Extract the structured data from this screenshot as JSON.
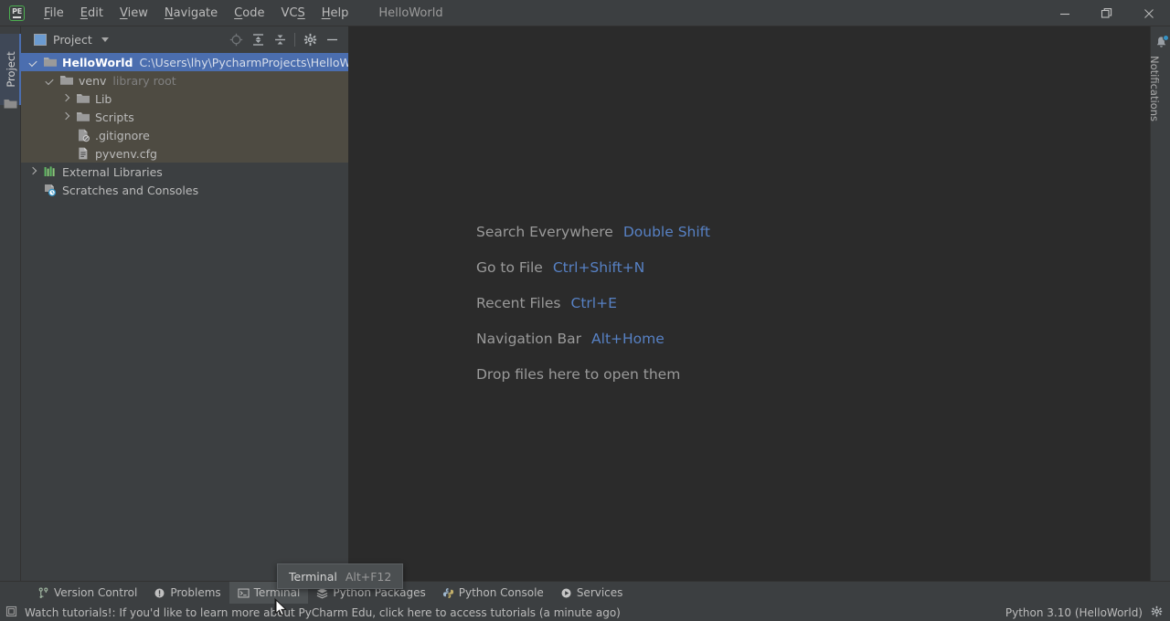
{
  "window": {
    "app_logo": "PE",
    "title": "HelloWorld",
    "minimize_label": "Minimize",
    "restore_label": "Restore",
    "close_label": "Close"
  },
  "menubar": {
    "items": [
      {
        "label": "File",
        "mnemonic": "F"
      },
      {
        "label": "Edit",
        "mnemonic": "E"
      },
      {
        "label": "View",
        "mnemonic": "V"
      },
      {
        "label": "Navigate",
        "mnemonic": "N"
      },
      {
        "label": "Code",
        "mnemonic": "C"
      },
      {
        "label": "VCS",
        "mnemonic": "S"
      },
      {
        "label": "Help",
        "mnemonic": "H"
      }
    ]
  },
  "left_stripe": {
    "tab_label": "Project",
    "icon": "folder-icon"
  },
  "right_stripe": {
    "tab_label": "Notifications",
    "icon": "bell-icon",
    "badge_color": "#3592c4"
  },
  "project_panel": {
    "title": "Project",
    "title_icon": "project-view-icon",
    "tools": [
      {
        "name": "locate-icon",
        "label": "Select Opened File"
      },
      {
        "name": "expand-all-icon",
        "label": "Expand All"
      },
      {
        "name": "collapse-all-icon",
        "label": "Collapse All"
      },
      {
        "name": "gear-icon",
        "label": "Options"
      },
      {
        "name": "hide-icon",
        "label": "Hide"
      }
    ],
    "tree": [
      {
        "label": "HelloWorld",
        "sub": "C:\\Users\\lhy\\PycharmProjects\\HelloWorld",
        "icon": "folder-icon",
        "state": "expanded",
        "selected": true,
        "indent": 0
      },
      {
        "label": "venv",
        "sub": "library root",
        "icon": "folder-icon",
        "state": "expanded",
        "selected": false,
        "indent": 1
      },
      {
        "label": "Lib",
        "sub": "",
        "icon": "folder-icon",
        "state": "collapsed",
        "selected": false,
        "indent": 2
      },
      {
        "label": "Scripts",
        "sub": "",
        "icon": "folder-icon",
        "state": "collapsed",
        "selected": false,
        "indent": 2
      },
      {
        "label": ".gitignore",
        "sub": "",
        "icon": "gitignore-file-icon",
        "state": "leaf",
        "selected": false,
        "indent": 2
      },
      {
        "label": "pyvenv.cfg",
        "sub": "",
        "icon": "config-file-icon",
        "state": "leaf",
        "selected": false,
        "indent": 2
      },
      {
        "label": "External Libraries",
        "sub": "",
        "icon": "external-libraries-icon",
        "state": "collapsed",
        "selected": false,
        "indent": 0
      },
      {
        "label": "Scratches and Consoles",
        "sub": "",
        "icon": "scratches-icon",
        "state": "leaf",
        "selected": false,
        "indent": 0
      }
    ]
  },
  "editor": {
    "hints": [
      {
        "label": "Search Everywhere",
        "key": "Double Shift"
      },
      {
        "label": "Go to File",
        "key": "Ctrl+Shift+N"
      },
      {
        "label": "Recent Files",
        "key": "Ctrl+E"
      },
      {
        "label": "Navigation Bar",
        "key": "Alt+Home"
      },
      {
        "label": "Drop files here to open them",
        "key": ""
      }
    ],
    "hint_key_color": "#5781c4"
  },
  "tool_window_bar": {
    "buttons": [
      {
        "label": "Version Control",
        "icon": "branch-icon",
        "active": false
      },
      {
        "label": "Problems",
        "icon": "problems-icon",
        "active": false
      },
      {
        "label": "Terminal",
        "icon": "terminal-icon",
        "active": true
      },
      {
        "label": "Python Packages",
        "icon": "packages-icon",
        "active": false
      },
      {
        "label": "Python Console",
        "icon": "python-icon",
        "active": false
      },
      {
        "label": "Services",
        "icon": "services-icon",
        "active": false
      }
    ]
  },
  "tooltip": {
    "label": "Terminal",
    "shortcut": "Alt+F12"
  },
  "statusbar": {
    "icon": "event-log-icon",
    "message": "Watch tutorials!: If you'd like to learn more about PyCharm Edu, click here to access tutorials (a minute ago)",
    "interpreter": "Python 3.10 (HelloWorld)",
    "settings_icon": "gear-icon"
  }
}
